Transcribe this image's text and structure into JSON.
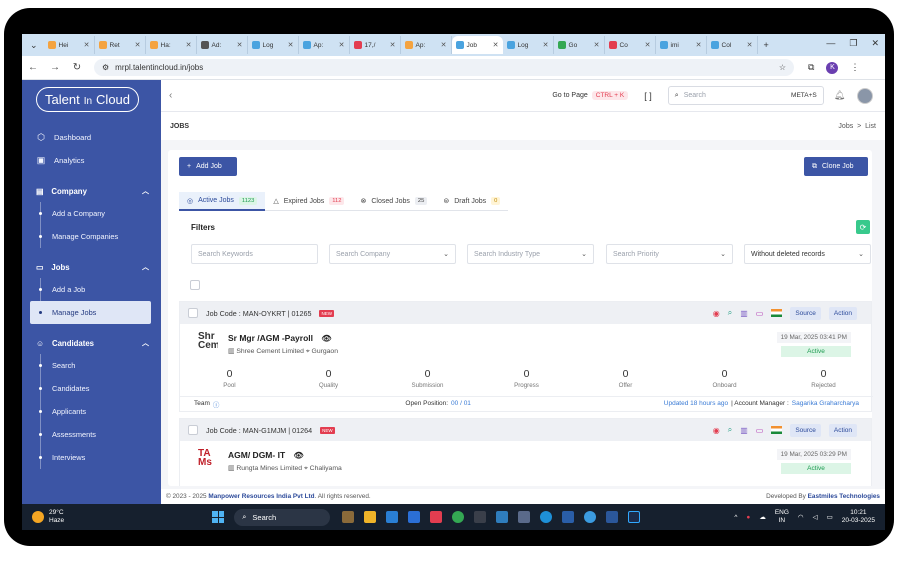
{
  "browser": {
    "tabs": [
      {
        "title": "Hei",
        "color": "#f4a340"
      },
      {
        "title": "Ret",
        "color": "#f4a340"
      },
      {
        "title": "Ha:",
        "color": "#f4a340"
      },
      {
        "title": "Ad:",
        "color": "#555555"
      },
      {
        "title": "Log",
        "color": "#4aa3df"
      },
      {
        "title": "Ap:",
        "color": "#4aa3df"
      },
      {
        "title": "17,/",
        "color": "#e33d50"
      },
      {
        "title": "Ap:",
        "color": "#f4a340"
      },
      {
        "title": "Job",
        "color": "#4aa3df",
        "active": true
      },
      {
        "title": "Log",
        "color": "#4aa3df"
      },
      {
        "title": "Go",
        "color": "#34a853"
      },
      {
        "title": "Co",
        "color": "#e33d50"
      },
      {
        "title": "imi",
        "color": "#4aa3df"
      },
      {
        "title": "Col",
        "color": "#4aa3df"
      }
    ],
    "url": "mrpl.talentincloud.in/jobs",
    "profile_initial": "K"
  },
  "logo": {
    "part1": "Talent",
    "part2": "In",
    "part3": "Cloud"
  },
  "sidebar": {
    "dashboard": "Dashboard",
    "analytics": "Analytics",
    "company": "Company",
    "add_company": "Add a Company",
    "manage_companies": "Manage Companies",
    "jobs": "Jobs",
    "add_job": "Add a Job",
    "manage_jobs": "Manage Jobs",
    "candidates": "Candidates",
    "search": "Search",
    "candidates_item": "Candidates",
    "applicants": "Applicants",
    "assessments": "Assessments",
    "interviews": "Interviews"
  },
  "topbar": {
    "goto": "Go to Page",
    "shortcut": "CTRL + K",
    "brackets": "[ ]",
    "search_placeholder": "Search",
    "search_shortcut": "META+S"
  },
  "page": {
    "title": "JOBS",
    "crumb1": "Jobs",
    "crumb_sep": ">",
    "crumb2": "List"
  },
  "actions": {
    "add_job": "Add Job",
    "clone_job": "Clone Job"
  },
  "tabs": {
    "active": {
      "label": "Active Jobs",
      "count": "1123"
    },
    "expired": {
      "label": "Expired Jobs",
      "count": "112"
    },
    "closed": {
      "label": "Closed Jobs",
      "count": "25"
    },
    "draft": {
      "label": "Draft Jobs",
      "count": "0"
    }
  },
  "filters": {
    "title": "Filters",
    "keywords": "Search Keywords",
    "company": "Search Company",
    "industry": "Search Industry Type",
    "priority": "Search Priority",
    "deleted": "Without deleted records"
  },
  "jobs": [
    {
      "code": "Job Code : MAN-OYKRT | 01265",
      "new": "NEW",
      "logo": "Shr Cem",
      "title": "Sr Mgr /AGM -Payroll",
      "company": "Shree Cement Limited",
      "location": "Gurgaon",
      "date": "19 Mar, 2025 03:41 PM",
      "status": "Active",
      "stats": [
        {
          "value": "0",
          "label": "Pool"
        },
        {
          "value": "0",
          "label": "Quality"
        },
        {
          "value": "0",
          "label": "Submission"
        },
        {
          "value": "0",
          "label": "Progress"
        },
        {
          "value": "0",
          "label": "Offer"
        },
        {
          "value": "0",
          "label": "Onboard"
        },
        {
          "value": "0",
          "label": "Rejected"
        }
      ],
      "team": "Team",
      "open_position_label": "Open Position:",
      "open_position": "00 / 01",
      "updated": "Updated 18 hours ago",
      "manager_label": "| Account Manager :",
      "manager": "Sagarika Graharcharya"
    },
    {
      "code": "Job Code : MAN-G1MJM | 01264",
      "new": "NEW",
      "logo": "TA Ms",
      "title": "AGM/ DGM- IT",
      "company": "Rungta Mines Limited",
      "location": "Chaliyama",
      "date": "19 Mar, 2025 03:29 PM",
      "status": "Active"
    }
  ],
  "job_buttons": {
    "source": "Source",
    "action": "Action"
  },
  "footer": {
    "left_prefix": "© 2023 - 2025",
    "company": "Manpower Resources India Pvt Ltd",
    "left_suffix": ". All rights reserved.",
    "right_prefix": "Developed By",
    "developer": "Eastmiles Technologies"
  },
  "taskbar": {
    "temp": "29°C",
    "weather": "Haze",
    "search": "Search",
    "lang1": "ENG",
    "lang2": "IN",
    "time": "10:21",
    "date": "20-03-2025"
  },
  "colors": {
    "primary": "#3c55a5",
    "active_status": "#1d9b50",
    "new_badge": "#e33d50"
  }
}
